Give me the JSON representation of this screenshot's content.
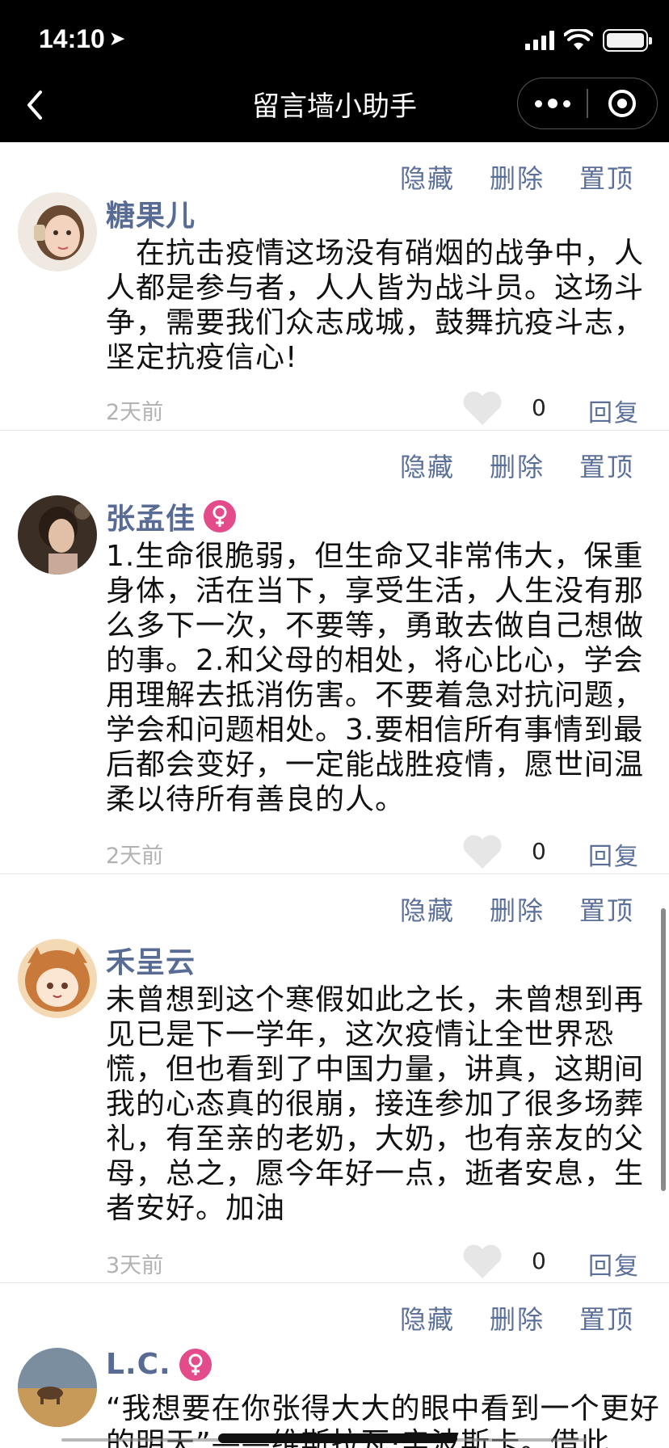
{
  "status": {
    "time": "14:10"
  },
  "nav": {
    "title": "留言墙小助手"
  },
  "icons": {
    "back": "chevron-left-icon",
    "more": "more-dots-icon",
    "close": "target-circle-icon",
    "like": "heart-icon",
    "gender": "female-icon"
  },
  "colors": {
    "link": "#576b95",
    "female_badge": "#e44b8a",
    "time": "#b2b2b2"
  },
  "messages": [
    {
      "actions": [
        "隐藏",
        "删除",
        "置顶"
      ],
      "name": "糖果儿",
      "content": "　在抗击疫情这场没有硝烟的战争中，人人都是参与者，人人皆为战斗员。这场斗争，需要我们众志成城，鼓舞抗疫斗志，坚定抗疫信心!",
      "time": "2天前",
      "likes": "0",
      "reply": "回复"
    },
    {
      "actions": [
        "隐藏",
        "删除",
        "置顶"
      ],
      "name": "张孟佳",
      "content": "1.生命很脆弱，但生命又非常伟大，保重身体，活在当下，享受生活，人生没有那么多下一次，不要等，勇敢去做自己想做的事。2.和父母的相处，将心比心，学会用理解去抵消伤害。不要着急对抗问题，学会和问题相处。3.要相信所有事情到最后都会变好，一定能战胜疫情，愿世间温柔以待所有善良的人。",
      "time": "2天前",
      "likes": "0",
      "reply": "回复"
    },
    {
      "actions": [
        "隐藏",
        "删除",
        "置顶"
      ],
      "name": "禾呈云",
      "content": "未曾想到这个寒假如此之长，未曾想到再见已是下一学年，这次疫情让全世界恐慌，但也看到了中国力量，讲真，这期间我的心态真的很崩，接连参加了很多场葬礼，有至亲的老奶，大奶，也有亲友的父母，总之，愿今年好一点，逝者安息，生者安好。加油",
      "time": "3天前",
      "likes": "0",
      "reply": "回复"
    },
    {
      "actions": [
        "隐藏",
        "删除",
        "置顶"
      ],
      "name": "L.C.",
      "content": "“我想要在你张得大大的眼中看到一个更好的明天”——维斯拉瓦·辛波斯卡。借此"
    }
  ]
}
